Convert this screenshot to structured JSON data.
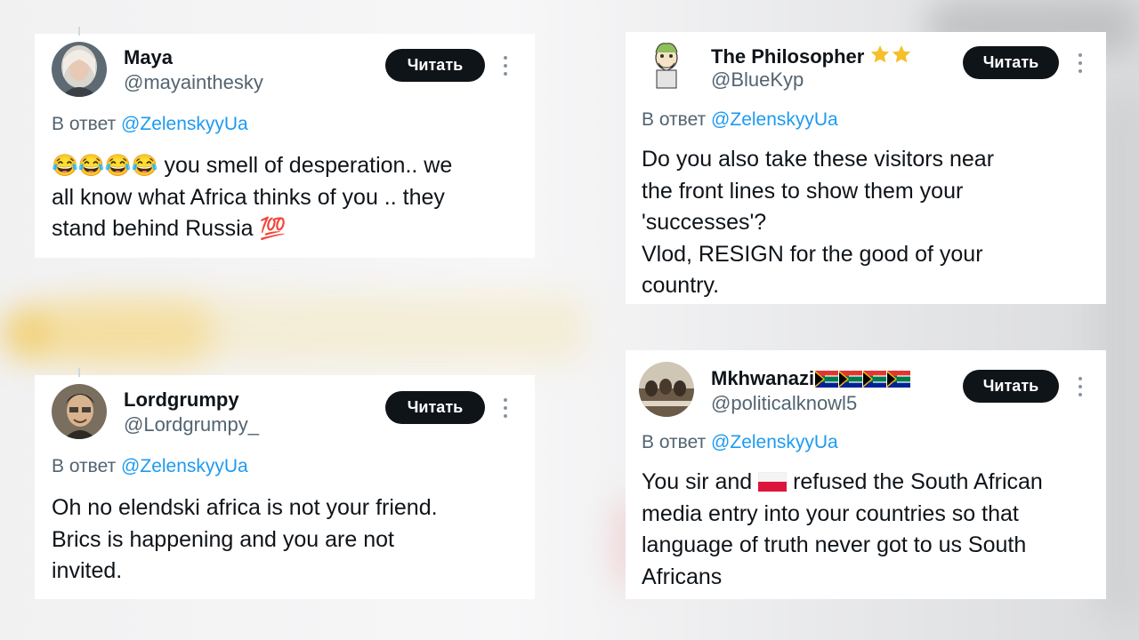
{
  "tweets": [
    {
      "name": "Maya",
      "handle": "@mayainthesky",
      "follow_label": "Читать",
      "reply_prefix": "В ответ",
      "reply_to": "@ZelenskyyUa",
      "emoji_lead": "😂😂😂😂",
      "text": " you smell of desperation.. we\nall know what Africa thinks of you .. they\nstand behind Russia ",
      "emoji_tail": "💯"
    },
    {
      "name": "The Philosopher",
      "name_badges": "⭐⭐",
      "handle": "@BlueKyp",
      "follow_label": "Читать",
      "reply_prefix": "В ответ",
      "reply_to": "@ZelenskyyUa",
      "text": "Do you also take these visitors near\nthe front lines to show them your\n'successes'?\nVlod, RESIGN for the good of your\ncountry."
    },
    {
      "name": "Lordgrumpy",
      "handle": "@Lordgrumpy_",
      "follow_label": "Читать",
      "reply_prefix": "В ответ",
      "reply_to": "@ZelenskyyUa",
      "text": "Oh no elendski africa is not your friend.\nBrics is happening and you are not\ninvited."
    },
    {
      "name": "Mkhwanazi",
      "name_badges": "🇿🇦🇿🇦🇿🇦🇿🇦",
      "handle": "@politicalknowl5",
      "follow_label": "Читать",
      "reply_prefix": "В ответ",
      "reply_to": "@ZelenskyyUa",
      "text_before_flag": "You sir and ",
      "inline_flag": "🇵🇱",
      "text": " refused the South African\nmedia entry into your countries so that\nlanguage of truth never got to us South\nAfricans"
    }
  ],
  "colors": {
    "follow_button_bg": "#0f1419",
    "mention": "#1d9bf0",
    "secondary_text": "#536471"
  },
  "icons": [
    "more-options-icon",
    "star-icon",
    "south-africa-flag-icon",
    "poland-flag-icon"
  ]
}
